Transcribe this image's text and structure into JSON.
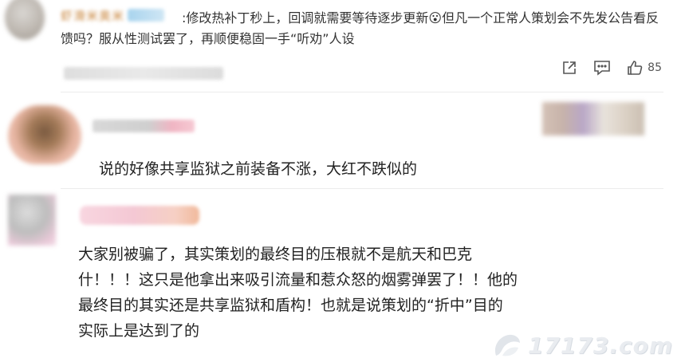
{
  "comment1": {
    "text": ":修改热补丁秒上，回调就需要等待逐步更新😮但凡一个正常人策划会不先发公告看反馈吗？服从性测试罢了，再顺便稳固一手“听劝”人设",
    "likes": "85",
    "icons": [
      "share-icon",
      "comment-icon",
      "like-icon"
    ]
  },
  "comment2": {
    "text": "说的好像共享监狱之前装备不涨，大红不跌似的"
  },
  "comment3": {
    "lines": [
      "大家别被骗了，其实策划的最终目的压根就不是航天和巴克",
      "什！！！这只是他拿出来吸引流量和惹众怒的烟雾弹罢了！！他的",
      "最终目的其实还是共享监狱和盾构！也就是说策划的“折中”目的",
      "实际上是达到了的"
    ]
  },
  "watermark": {
    "text": "17173.com"
  },
  "colors": {
    "text": "#222222",
    "meta": "#555555",
    "divider": "#ececec"
  }
}
